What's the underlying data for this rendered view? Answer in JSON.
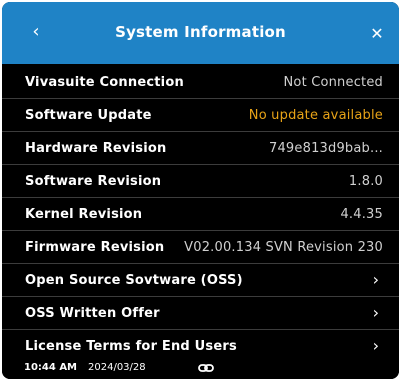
{
  "header": {
    "title": "System Information",
    "back_icon": "chevron-left-icon",
    "close_icon": "close-icon"
  },
  "rows": [
    {
      "label": "Vivasuite Connection",
      "value": "Not Connected"
    },
    {
      "label": "Software Update",
      "value": "No update available",
      "value_color": "#e8a317"
    },
    {
      "label": "Hardware Revision",
      "value": "749e813d9bab..."
    },
    {
      "label": "Software Revision",
      "value": "1.8.0"
    },
    {
      "label": "Kernel Revision",
      "value": "4.4.35"
    },
    {
      "label": "Firmware Revision",
      "value": "V02.00.134 SVN Revision 230"
    },
    {
      "label": "Open Source Sovtware (OSS)",
      "icon": "chevron-right-icon"
    },
    {
      "label": "OSS Written Offer",
      "icon": "chevron-right-icon"
    },
    {
      "label": "License Terms for End Users",
      "icon": "chevron-right-icon"
    }
  ],
  "status_bar": {
    "time": "10:44 AM",
    "date": "2024/03/28",
    "icon": "link-icon"
  },
  "colors": {
    "header_bg": "#1f83c6",
    "background": "#000000",
    "warning": "#e8a317"
  }
}
